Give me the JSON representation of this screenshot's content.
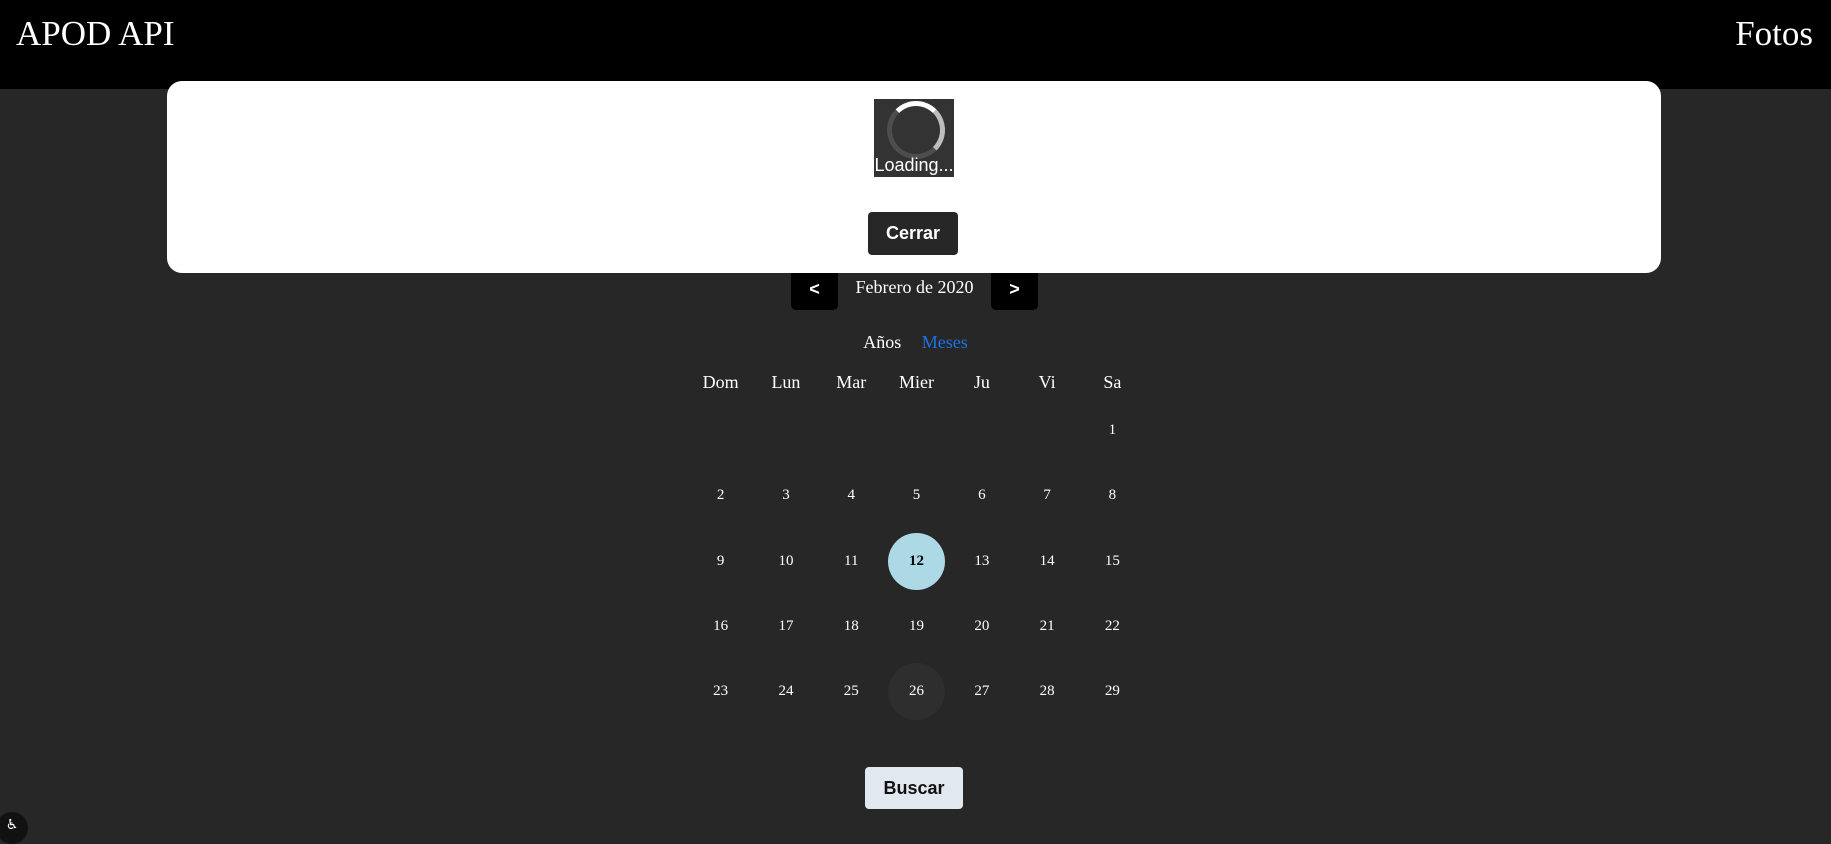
{
  "header": {
    "brand": "APOD API",
    "nav_link": "Fotos"
  },
  "modal": {
    "loading_text": "Loading...",
    "close_label": "Cerrar"
  },
  "month_nav": {
    "prev_label": "<",
    "next_label": ">",
    "month_label": "Febrero de 2020"
  },
  "view_toggle": {
    "years_label": "Años",
    "months_label": "Meses",
    "active": "Meses"
  },
  "calendar": {
    "weekdays": [
      "Dom",
      "Lun",
      "Mar",
      "Mier",
      "Ju",
      "Vi",
      "Sa"
    ],
    "leading_blanks": 6,
    "days": [
      "1",
      "2",
      "3",
      "4",
      "5",
      "6",
      "7",
      "8",
      "9",
      "10",
      "11",
      "12",
      "13",
      "14",
      "15",
      "16",
      "17",
      "18",
      "19",
      "20",
      "21",
      "22",
      "23",
      "24",
      "25",
      "26",
      "27",
      "28",
      "29"
    ],
    "selected_day": "12",
    "hovered_day": "26",
    "selected_color": "#add8e6"
  },
  "search_label": "Buscar",
  "corner_icon": "accessibility-icon"
}
